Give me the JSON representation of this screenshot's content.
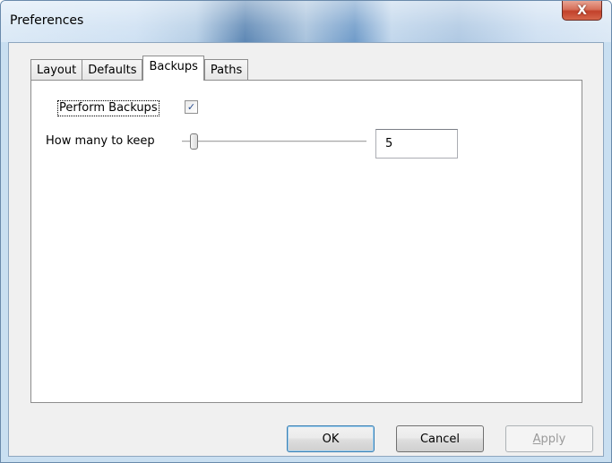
{
  "window": {
    "title": "Preferences",
    "close_glyph": "X"
  },
  "tabs": [
    {
      "label": "Layout",
      "active": false
    },
    {
      "label": "Defaults",
      "active": false
    },
    {
      "label": "Backups",
      "active": true
    },
    {
      "label": "Paths",
      "active": false
    }
  ],
  "backups": {
    "perform_label": "Perform Backups",
    "perform_checked": true,
    "check_glyph": "✓",
    "keep_label": "How many to keep",
    "keep_slider_value": 5,
    "keep_value": "5"
  },
  "buttons": {
    "ok": "OK",
    "cancel": "Cancel",
    "apply_mnemonic": "A",
    "apply_rest": "pply"
  },
  "colors": {
    "ok_focus_border": "#3c7fb1",
    "close_red": "#c2412b",
    "checkmark": "#2a4d8f"
  },
  "icons": {
    "close": "close-icon",
    "check": "checkmark-icon"
  }
}
